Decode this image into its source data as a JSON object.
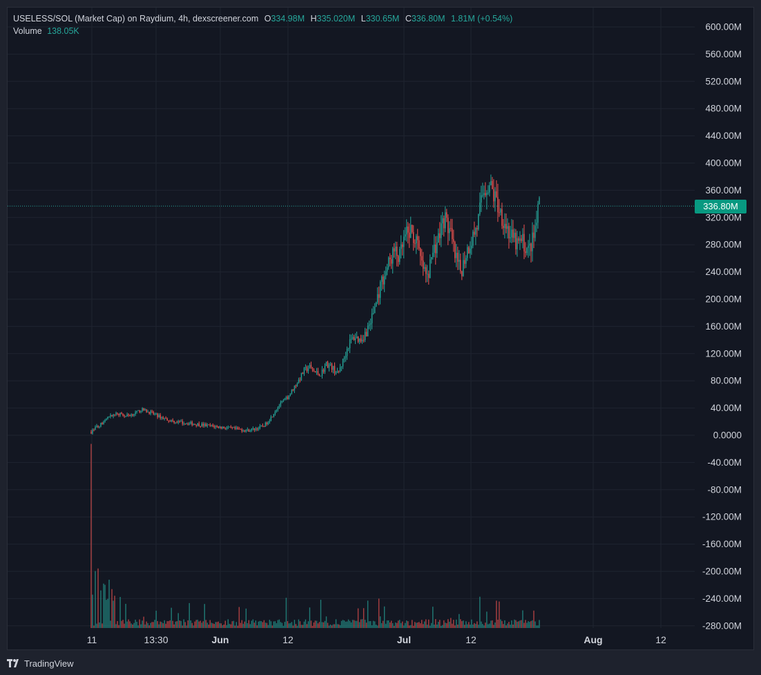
{
  "legend": {
    "title": "USELESS/SOL (Market Cap) on Raydium, 4h, dexscreener.com",
    "open_label": "O",
    "open": "334.98M",
    "high_label": "H",
    "high": "335.020M",
    "low_label": "L",
    "low": "330.65M",
    "close_label": "C",
    "close": "336.80M",
    "change": "1.81M (+0.54%)",
    "volume_label": "Volume",
    "volume": "138.05K"
  },
  "last_price_label": "336.80M",
  "footer": {
    "brand": "TradingView"
  },
  "colors": {
    "up": "#26a69a",
    "down": "#ef5350",
    "grid": "#1f2430",
    "axis_text": "#d1d4dc"
  },
  "chart_data": {
    "type": "candlestick",
    "interval": "4h",
    "y_ticks": [
      "600.00M",
      "560.00M",
      "520.00M",
      "480.00M",
      "440.00M",
      "400.00M",
      "360.00M",
      "320.00M",
      "280.00M",
      "240.00M",
      "200.00M",
      "160.00M",
      "120.00M",
      "80.00M",
      "40.00M",
      "0.0000",
      "-40.00M",
      "-80.00M",
      "-120.00M",
      "-160.00M",
      "-200.00M",
      "-240.00M",
      "-280.00M"
    ],
    "ylim_millions": [
      -280,
      600
    ],
    "x_ticks": [
      "11",
      "13:30",
      "Jun",
      "12",
      "Jul",
      "12",
      "Aug",
      "12"
    ],
    "last_value_millions": 336.8,
    "market_cap_path_millions": [
      [
        0,
        5
      ],
      [
        1,
        12
      ],
      [
        2,
        18
      ],
      [
        3,
        26
      ],
      [
        4,
        30
      ],
      [
        5,
        32
      ],
      [
        6,
        28
      ],
      [
        7,
        30
      ],
      [
        8,
        33
      ],
      [
        9,
        38
      ],
      [
        10,
        35
      ],
      [
        11,
        32
      ],
      [
        12,
        28
      ],
      [
        13,
        25
      ],
      [
        14,
        22
      ],
      [
        15,
        20
      ],
      [
        16,
        19
      ],
      [
        17,
        18
      ],
      [
        18,
        17
      ],
      [
        19,
        16
      ],
      [
        20,
        15
      ],
      [
        21,
        14
      ],
      [
        22,
        13
      ],
      [
        23,
        12
      ],
      [
        24,
        11
      ],
      [
        25,
        10
      ],
      [
        26,
        9
      ],
      [
        27,
        8
      ],
      [
        28,
        7
      ],
      [
        29,
        9
      ],
      [
        30,
        11
      ],
      [
        31,
        15
      ],
      [
        32,
        25
      ],
      [
        33,
        38
      ],
      [
        34,
        48
      ],
      [
        35,
        55
      ],
      [
        36,
        68
      ],
      [
        37,
        80
      ],
      [
        38,
        95
      ],
      [
        39,
        100
      ],
      [
        40,
        92
      ],
      [
        41,
        90
      ],
      [
        42,
        105
      ],
      [
        43,
        100
      ],
      [
        44,
        90
      ],
      [
        45,
        110
      ],
      [
        46,
        135
      ],
      [
        47,
        145
      ],
      [
        48,
        140
      ],
      [
        49,
        150
      ],
      [
        50,
        170
      ],
      [
        51,
        200
      ],
      [
        52,
        230
      ],
      [
        53,
        250
      ],
      [
        54,
        270
      ],
      [
        55,
        260
      ],
      [
        56,
        290
      ],
      [
        57,
        300
      ],
      [
        58,
        285
      ],
      [
        59,
        250
      ],
      [
        60,
        230
      ],
      [
        61,
        270
      ],
      [
        62,
        290
      ],
      [
        63,
        320
      ],
      [
        64,
        300
      ],
      [
        65,
        260
      ],
      [
        66,
        240
      ],
      [
        67,
        270
      ],
      [
        68,
        290
      ],
      [
        69,
        310
      ],
      [
        70,
        360
      ],
      [
        71,
        370
      ],
      [
        72,
        350
      ],
      [
        73,
        330
      ],
      [
        74,
        310
      ],
      [
        75,
        290
      ],
      [
        76,
        280
      ],
      [
        77,
        285
      ],
      [
        78,
        270
      ],
      [
        79,
        290
      ],
      [
        80,
        337
      ]
    ]
  }
}
